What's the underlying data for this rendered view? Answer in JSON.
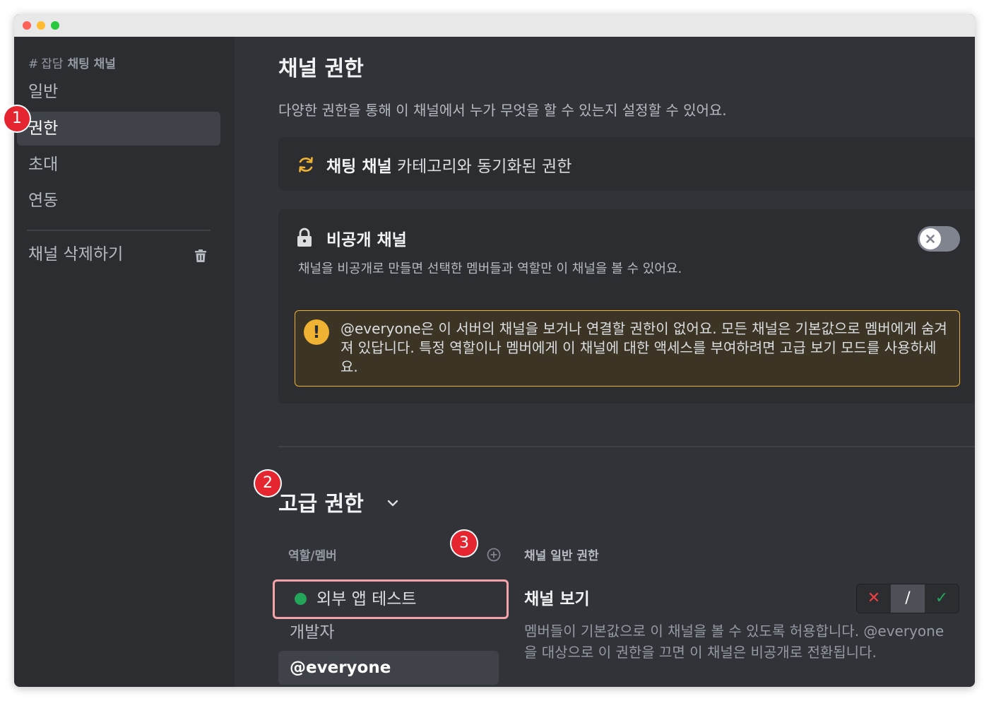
{
  "sidebar": {
    "header_hash": "#",
    "header_prefix": "잡담",
    "header_bold": "채팅 채널",
    "items": [
      {
        "label": "일반"
      },
      {
        "label": "권한",
        "active": true
      },
      {
        "label": "초대"
      },
      {
        "label": "연동"
      }
    ],
    "delete_label": "채널 삭제하기"
  },
  "badges": [
    "1",
    "2",
    "3"
  ],
  "main": {
    "title": "채널 권한",
    "description": "다양한 권한을 통해 이 채널에서 누가 무엇을 할 수 있는지 설정할 수 있어요.",
    "sync": {
      "category_bold": "채팅 채널",
      "rest": " 카테고리와 동기화된 권한"
    },
    "private_channel": {
      "title": "비공개 채널",
      "description": "채널을 비공개로 만들면 선택한 멤버들과 역할만 이 채널을 볼 수 있어요.",
      "toggle_on": false,
      "warning_icon": "!",
      "warning": "@everyone은 이 서버의 채널을 보거나 연결할 권한이 없어요. 모든 채널은 기본값으로 멤버에게 숨겨져 있답니다. 특정 역할이나 멤버에게 이 채널에 대한 액세스를 부여하려면 고급 보기 모드를 사용하세요."
    },
    "advanced": {
      "title": "고급 권한",
      "roles_header": "역할/멤버",
      "roles": [
        {
          "label": "외부 앱 테스트",
          "dot_color": "#23a55a"
        },
        {
          "label": "개발자"
        },
        {
          "label": "@everyone"
        }
      ],
      "perm_section": "채널 일반 권한",
      "perm_name": "채널 보기",
      "perm_desc": "멤버들이 기본값으로 이 채널을 볼 수 있도록 허용합니다. @everyone을 대상으로 이 권한을 끄면 이 채널은 비공개로 전환됩니다.",
      "tri_state": {
        "deny": "✕",
        "neutral": "/",
        "allow": "✓",
        "selected": "neutral"
      }
    }
  },
  "colors": {
    "accent_warning": "#f0b232",
    "deny": "#f23f43",
    "allow": "#23a55a",
    "badge": "#e5252f",
    "highlight_border": "#f4a3a8"
  }
}
